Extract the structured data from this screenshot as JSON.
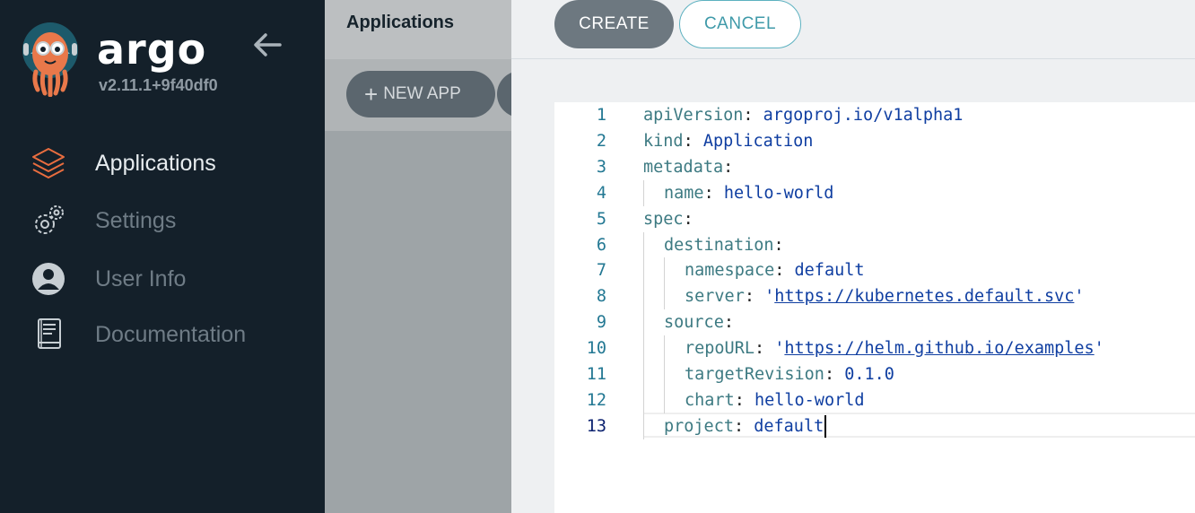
{
  "sidebar": {
    "brand": "argo",
    "version": "v2.11.1+9f40df0",
    "nav": [
      {
        "label": "Applications",
        "icon": "layers-icon",
        "active": true
      },
      {
        "label": "Settings",
        "icon": "gears-icon",
        "active": false
      },
      {
        "label": "User Info",
        "icon": "user-circle-icon",
        "active": false
      },
      {
        "label": "Documentation",
        "icon": "book-icon",
        "active": false
      }
    ]
  },
  "main": {
    "title": "Applications",
    "new_app_label": "NEW APP"
  },
  "panel": {
    "create_label": "CREATE",
    "cancel_label": "CANCEL",
    "editor": {
      "current_line": 13,
      "lines": [
        {
          "num": "1",
          "indent": 0,
          "key": "apiVersion",
          "value": "argoproj.io/v1alpha1",
          "link": false
        },
        {
          "num": "2",
          "indent": 0,
          "key": "kind",
          "value": "Application",
          "link": false
        },
        {
          "num": "3",
          "indent": 0,
          "key": "metadata",
          "value": "",
          "link": false
        },
        {
          "num": "4",
          "indent": 1,
          "key": "name",
          "value": "hello-world",
          "link": false
        },
        {
          "num": "5",
          "indent": 0,
          "key": "spec",
          "value": "",
          "link": false
        },
        {
          "num": "6",
          "indent": 1,
          "key": "destination",
          "value": "",
          "link": false
        },
        {
          "num": "7",
          "indent": 2,
          "key": "namespace",
          "value": "default",
          "link": false
        },
        {
          "num": "8",
          "indent": 2,
          "key": "server",
          "value": "https://kubernetes.default.svc",
          "link": true
        },
        {
          "num": "9",
          "indent": 1,
          "key": "source",
          "value": "",
          "link": false
        },
        {
          "num": "10",
          "indent": 2,
          "key": "repoURL",
          "value": "https://helm.github.io/examples",
          "link": true
        },
        {
          "num": "11",
          "indent": 2,
          "key": "targetRevision",
          "value": "0.1.0",
          "link": false
        },
        {
          "num": "12",
          "indent": 2,
          "key": "chart",
          "value": "hello-world",
          "link": false
        },
        {
          "num": "13",
          "indent": 1,
          "key": "project",
          "value": "default",
          "link": false
        }
      ]
    }
  },
  "colors": {
    "sidebar_bg": "#14202a",
    "accent_orange": "#e96d3f",
    "create_bg": "#6d7880",
    "cancel_border": "#5cb1c0"
  }
}
